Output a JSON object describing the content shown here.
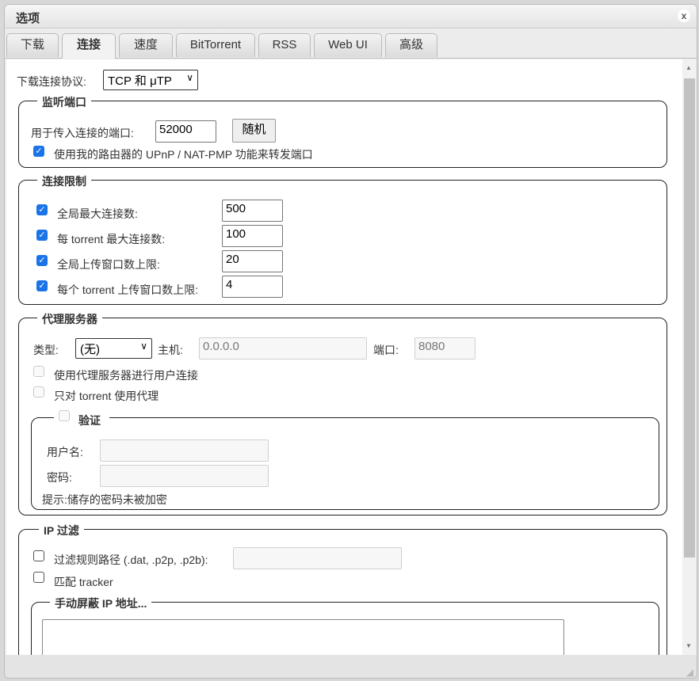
{
  "window": {
    "title": "选项",
    "close": "x"
  },
  "tabs": [
    "下载",
    "连接",
    "速度",
    "BitTorrent",
    "RSS",
    "Web UI",
    "高级"
  ],
  "protocol": {
    "label": "下载连接协议:",
    "value": "TCP 和 μTP"
  },
  "listen": {
    "legend": "监听端口",
    "port_label": "用于传入连接的端口:",
    "port": "52000",
    "random": "随机",
    "upnp": "使用我的路由器的 UPnP / NAT-PMP 功能来转发端口"
  },
  "limits": {
    "legend": "连接限制",
    "rows": [
      {
        "label": "全局最大连接数:",
        "value": "500"
      },
      {
        "label": "每 torrent 最大连接数:",
        "value": "100"
      },
      {
        "label": "全局上传窗口数上限:",
        "value": "20"
      },
      {
        "label": "每个 torrent 上传窗口数上限:",
        "value": "4"
      }
    ]
  },
  "proxy": {
    "legend": "代理服务器",
    "type_label": "类型:",
    "type": "(无)",
    "host_label": "主机:",
    "host": "0.0.0.0",
    "port_label": "端口:",
    "port": "8080",
    "peer": "使用代理服务器进行用户连接",
    "only_torrents": "只对 torrent 使用代理",
    "auth": {
      "legend": "验证",
      "user_label": "用户名:",
      "pass_label": "密码:",
      "hint": "提示:储存的密码未被加密"
    }
  },
  "ipfilter": {
    "legend": "IP 过滤",
    "path_label": "过滤规则路径 (.dat, .p2p, .p2b):",
    "trackers": "匹配 tracker",
    "manual_legend": "手动屏蔽 IP 地址..."
  }
}
